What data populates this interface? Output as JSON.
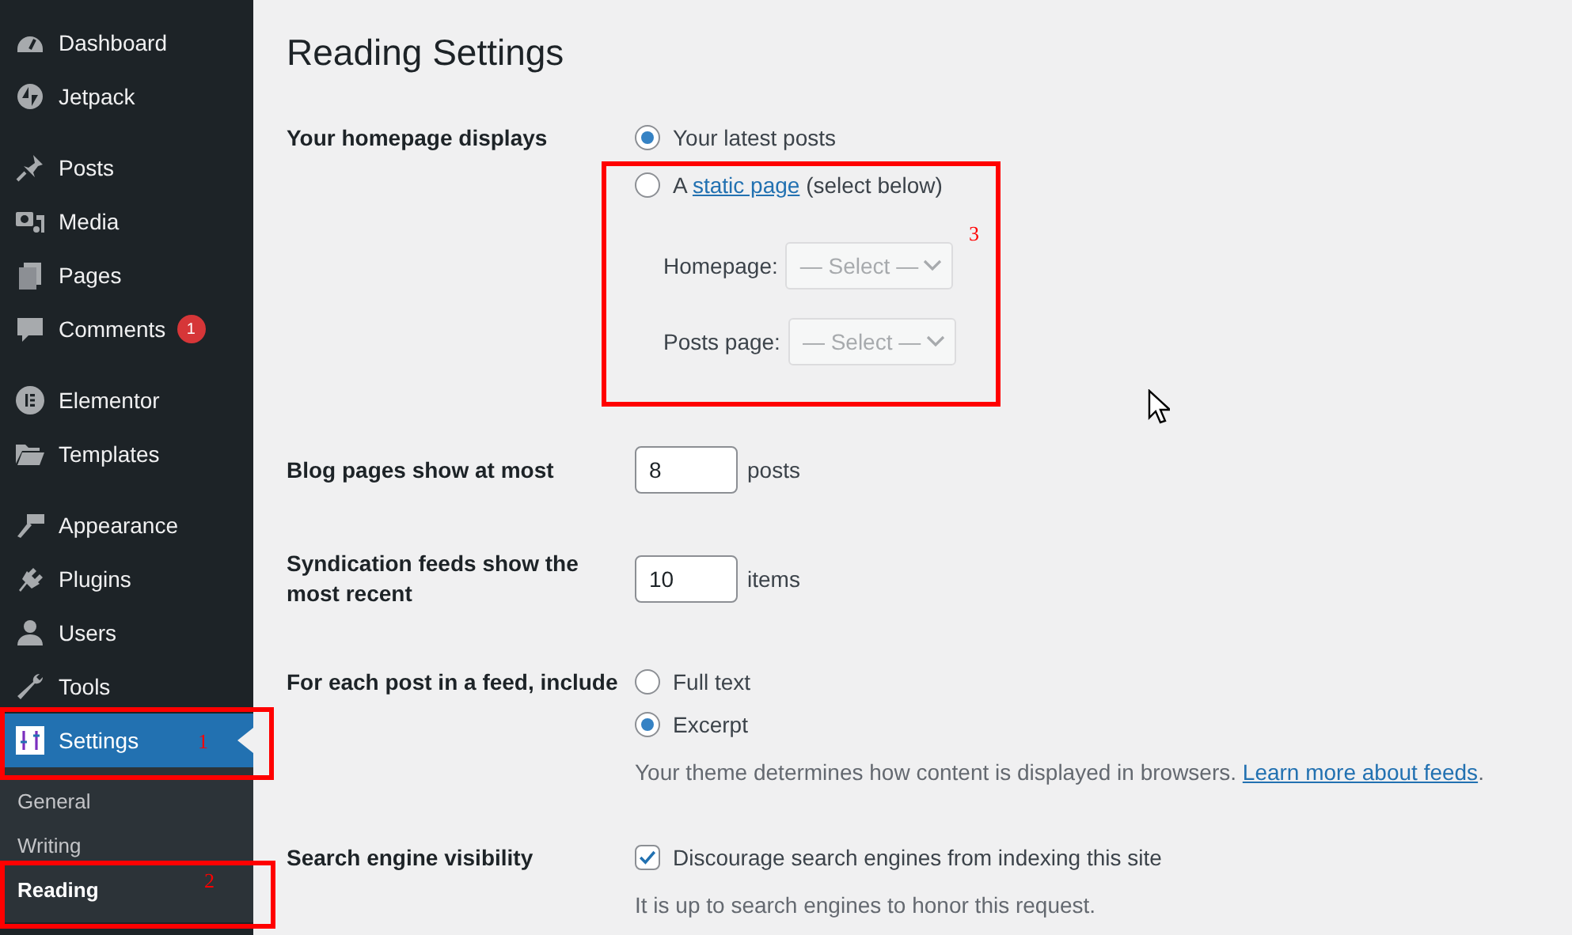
{
  "sidebar": {
    "groups": [
      [
        {
          "label": "Dashboard",
          "selected": false
        },
        {
          "label": "Jetpack",
          "selected": false
        }
      ],
      [
        {
          "label": "Posts",
          "selected": false
        },
        {
          "label": "Media",
          "selected": false
        },
        {
          "label": "Pages",
          "selected": false
        },
        {
          "label": "Comments",
          "selected": false,
          "badge": "1"
        }
      ],
      [
        {
          "label": "Elementor",
          "selected": false
        },
        {
          "label": "Templates",
          "selected": false
        }
      ],
      [
        {
          "label": "Appearance",
          "selected": false
        },
        {
          "label": "Plugins",
          "selected": false
        },
        {
          "label": "Users",
          "selected": false
        },
        {
          "label": "Tools",
          "selected": false
        },
        {
          "label": "Settings",
          "selected": true,
          "children": [
            {
              "label": "General",
              "selected": false
            },
            {
              "label": "Writing",
              "selected": false
            },
            {
              "label": "Reading",
              "selected": true
            }
          ]
        }
      ]
    ]
  },
  "page_title": "Reading Settings",
  "rows": [
    {
      "kind": "radio",
      "label": "Your homepage displays",
      "options": [
        {
          "text": "Your latest posts",
          "selected": true
        },
        {
          "text": "A ",
          "link": "static page",
          "after": " (select below)",
          "selected": false
        }
      ],
      "selects": [
        {
          "label": "Homepage:",
          "value": "— Select —",
          "disabled": true
        },
        {
          "label": "Posts page:",
          "value": "— Select —",
          "disabled": true
        }
      ]
    },
    {
      "kind": "number",
      "label": "Blog pages show at most",
      "value": "8",
      "unit": "posts"
    },
    {
      "kind": "number",
      "label": "Syndication feeds show the most recent",
      "value": "10",
      "unit": "items"
    },
    {
      "kind": "radio",
      "label": "For each post in a feed, include",
      "options": [
        {
          "text": "Full text",
          "selected": false
        },
        {
          "text": "Excerpt",
          "selected": true
        }
      ],
      "description": {
        "text": "Your theme determines how content is displayed in browsers. ",
        "link": "Learn more about feeds",
        "after": "."
      }
    },
    {
      "kind": "checkbox",
      "label": "Search engine visibility",
      "checkbox": {
        "text": "Discourage search engines from indexing this site",
        "checked": true
      },
      "description": {
        "text": "It is up to search engines to honor this request."
      }
    }
  ],
  "annotations": [
    {
      "label": "1"
    },
    {
      "label": "2"
    },
    {
      "label": "3"
    }
  ]
}
